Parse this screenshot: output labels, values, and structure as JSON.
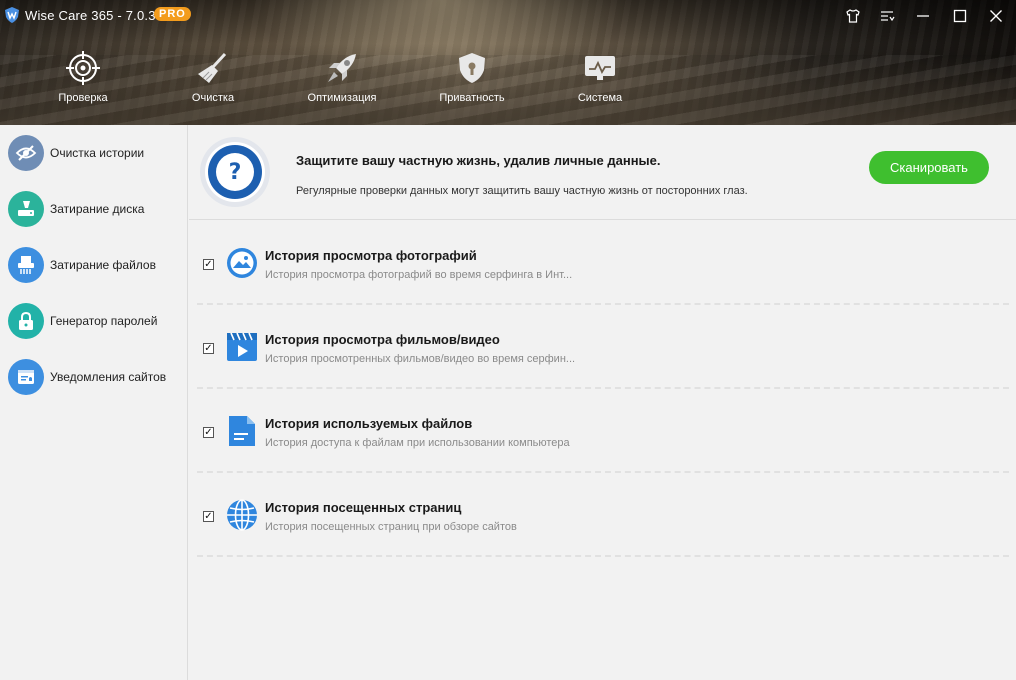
{
  "app": {
    "title": "Wise Care 365 - 7.0.3",
    "badge": "PRO"
  },
  "window_controls": {
    "skin_icon": "tshirt-icon",
    "menu_icon": "menu-icon",
    "minimize_icon": "minimize-icon",
    "maximize_icon": "maximize-icon",
    "close_icon": "close-icon"
  },
  "nav": {
    "items": [
      {
        "label": "Проверка",
        "icon": "crosshair-icon",
        "active": true
      },
      {
        "label": "Очистка",
        "icon": "broom-icon",
        "active": false
      },
      {
        "label": "Оптимизация",
        "icon": "rocket-icon",
        "active": false
      },
      {
        "label": "Приватность",
        "icon": "shield-lock-icon",
        "active": false
      },
      {
        "label": "Система",
        "icon": "monitor-icon",
        "active": false
      }
    ]
  },
  "sidebar": {
    "items": [
      {
        "label": "Очистка истории",
        "icon": "eye-off-icon",
        "color": "#5b7da8"
      },
      {
        "label": "Затирание диска",
        "icon": "disk-eraser-icon",
        "color": "#2bb39b"
      },
      {
        "label": "Затирание файлов",
        "icon": "shredder-icon",
        "color": "#3d8fe0"
      },
      {
        "label": "Генератор паролей",
        "icon": "lock-icon",
        "color": "#22b2a8"
      },
      {
        "label": "Уведомления сайтов",
        "icon": "web-notification-icon",
        "color": "#3d8fe0"
      }
    ]
  },
  "banner": {
    "title": "Защитите вашу частную жизнь, удалив личные данные.",
    "description": "Регулярные проверки данных могут защитить вашу частную жизнь от посторонних глаз.",
    "scan_label": "Сканировать",
    "icon": "question-icon"
  },
  "items": [
    {
      "title": "История просмотра фотографий",
      "description": "История просмотра фотографий во время серфинга в Инт...",
      "checked": true,
      "icon": "photo-icon"
    },
    {
      "title": "История просмотра фильмов/видео",
      "description": "История просмотренных фильмов/видео во время серфин...",
      "checked": true,
      "icon": "video-icon"
    },
    {
      "title": "История используемых файлов",
      "description": "История доступа к файлам при использовании компьютера",
      "checked": true,
      "icon": "document-icon"
    },
    {
      "title": "История посещенных страниц",
      "description": "История посещенных страниц при обзоре сайтов",
      "checked": true,
      "icon": "globe-icon"
    }
  ],
  "colors": {
    "accent_blue": "#1d5fb0",
    "scan_green": "#3fbf2f",
    "pro_orange": "#f39c1d",
    "icon_blue": "#2f86de"
  }
}
